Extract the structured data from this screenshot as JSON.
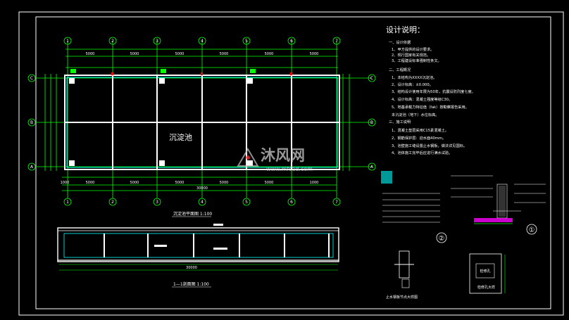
{
  "drawing": {
    "title_block": {
      "heading": "设计说明：",
      "lines": [
        "一、设计依据",
        "1、甲方提供的设计要求。",
        "2、现行国家有关规范。",
        "3、工程建设标准强制性条文。",
        "二、工程概况",
        "1、本结构为XXXX沉淀池。",
        "2、设计标高：±0.000。",
        "3、结构设计使用年限为50年，抗震设防烈度七度。",
        "4、设计标高：混凝土强度等级C30。",
        "5、地基承载力特征值（fak）按勘察报告采用。",
        "    本沉淀池（地下）水位标高。",
        "三、施工说明",
        "1、混凝土垫层采用C15素混凝土。",
        "2、钢筋保护层：迎水面40mm。",
        "3、池壁施工缝设置止水钢板，做法详见国标。",
        "4、池体施工完毕后应进行满水试验。"
      ]
    },
    "plan": {
      "pool_label": "沉淀池",
      "caption": "沉淀池平面图 1:100",
      "columns": [
        "1",
        "2",
        "3",
        "4",
        "5",
        "6",
        "7"
      ],
      "rows": [
        "C",
        "B",
        "A"
      ],
      "top_dims": [
        "5000",
        "5000",
        "5000",
        "5000",
        "5000",
        "5000"
      ],
      "bottom_dims": [
        "1000",
        "5000",
        "5000",
        "5000",
        "5000",
        "5000",
        "1000"
      ],
      "overall_dim": "30000"
    },
    "section": {
      "caption": "1—1剖面图 1:100",
      "overall_dim": "30000"
    },
    "details": {
      "detail_1": "①",
      "detail_2": "②",
      "node_caption": "止水钢板节点大样图",
      "pipe_caption": "检修孔大样",
      "manhole_label": "检修孔"
    },
    "watermark": {
      "brand": "沐风网",
      "url": "www.mfcad.com"
    },
    "colors": {
      "background": "#000000",
      "frame": "#ffffff",
      "grid": "#00ff00",
      "wall": "#00ffff",
      "accent": "#ff0000"
    }
  }
}
